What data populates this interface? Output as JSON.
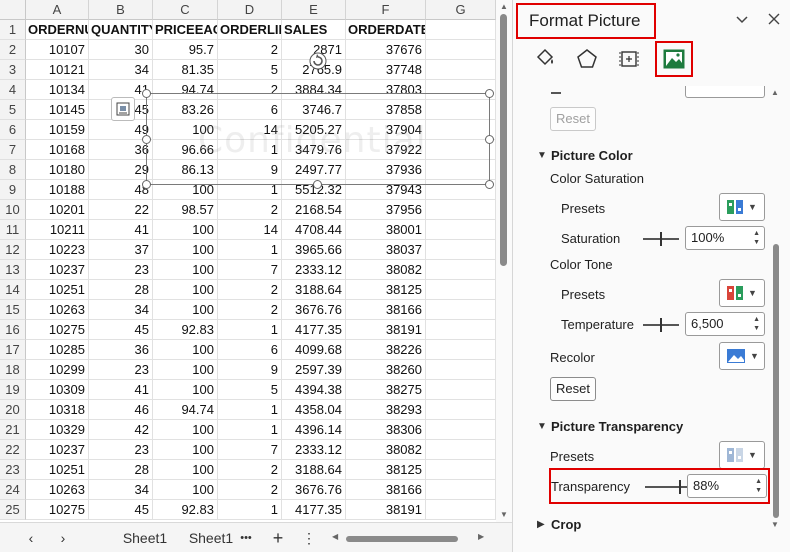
{
  "sheet": {
    "columns": [
      "A",
      "B",
      "C",
      "D",
      "E",
      "F",
      "G"
    ],
    "headers": [
      "ORDERNU",
      "QUANTITY",
      "PRICEEACH",
      "ORDERLIN",
      "SALES",
      "ORDERDATE",
      ""
    ],
    "rows": [
      [
        "10107",
        "30",
        "95.7",
        "2",
        "2871",
        "37676"
      ],
      [
        "10121",
        "34",
        "81.35",
        "5",
        "2765.9",
        "37748"
      ],
      [
        "10134",
        "41",
        "94.74",
        "2",
        "3884.34",
        "37803"
      ],
      [
        "10145",
        "45",
        "83.26",
        "6",
        "3746.7",
        "37858"
      ],
      [
        "10159",
        "49",
        "100",
        "14",
        "5205.27",
        "37904"
      ],
      [
        "10168",
        "36",
        "96.66",
        "1",
        "3479.76",
        "37922"
      ],
      [
        "10180",
        "29",
        "86.13",
        "9",
        "2497.77",
        "37936"
      ],
      [
        "10188",
        "48",
        "100",
        "1",
        "5512.32",
        "37943"
      ],
      [
        "10201",
        "22",
        "98.57",
        "2",
        "2168.54",
        "37956"
      ],
      [
        "10211",
        "41",
        "100",
        "14",
        "4708.44",
        "38001"
      ],
      [
        "10223",
        "37",
        "100",
        "1",
        "3965.66",
        "38037"
      ],
      [
        "10237",
        "23",
        "100",
        "7",
        "2333.12",
        "38082"
      ],
      [
        "10251",
        "28",
        "100",
        "2",
        "3188.64",
        "38125"
      ],
      [
        "10263",
        "34",
        "100",
        "2",
        "3676.76",
        "38166"
      ],
      [
        "10275",
        "45",
        "92.83",
        "1",
        "4177.35",
        "38191"
      ],
      [
        "10285",
        "36",
        "100",
        "6",
        "4099.68",
        "38226"
      ],
      [
        "10299",
        "23",
        "100",
        "9",
        "2597.39",
        "38260"
      ],
      [
        "10309",
        "41",
        "100",
        "5",
        "4394.38",
        "38275"
      ],
      [
        "10318",
        "46",
        "94.74",
        "1",
        "4358.04",
        "38293"
      ],
      [
        "10329",
        "42",
        "100",
        "1",
        "4396.14",
        "38306"
      ],
      [
        "10237",
        "23",
        "100",
        "7",
        "2333.12",
        "38082"
      ],
      [
        "10251",
        "28",
        "100",
        "2",
        "3188.64",
        "38125"
      ],
      [
        "10263",
        "34",
        "100",
        "2",
        "3676.76",
        "38166"
      ],
      [
        "10275",
        "45",
        "92.83",
        "1",
        "4177.35",
        "38191"
      ]
    ],
    "watermark": "Confidential",
    "tabs": [
      "Sheet1",
      "Sheet1"
    ],
    "tab_more": "•••",
    "add_tab": "+",
    "options": "⋮"
  },
  "pane": {
    "title": "Format Picture",
    "reset_top": "Reset",
    "picture_color": {
      "title": "Picture Color",
      "color_saturation": "Color Saturation",
      "presets_label": "Presets",
      "saturation_label": "Saturation",
      "saturation_value": "100%",
      "color_tone": "Color Tone",
      "tone_presets_label": "Presets",
      "temperature_label": "Temperature",
      "temperature_value": "6,500",
      "recolor_label": "Recolor",
      "reset": "Reset"
    },
    "transparency": {
      "title": "Picture Transparency",
      "presets_label": "Presets",
      "transparency_label": "Transparency",
      "transparency_value": "88%"
    },
    "crop": {
      "title": "Crop"
    }
  }
}
